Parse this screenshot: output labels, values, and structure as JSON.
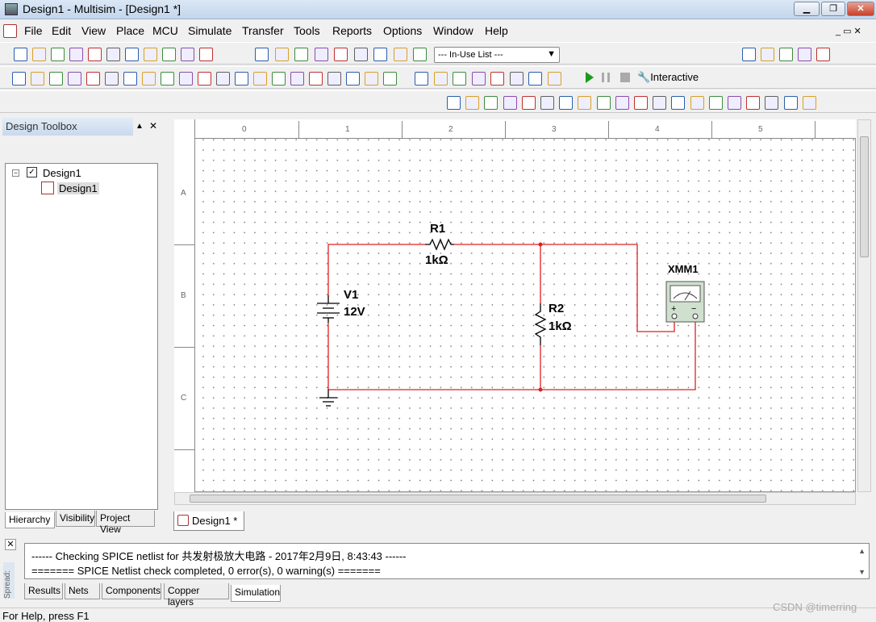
{
  "window": {
    "title": "Design1 - Multisim - [Design1 *]",
    "min": "▁",
    "max": "❐",
    "close": "✕"
  },
  "menu": [
    "File",
    "Edit",
    "View",
    "Place",
    "MCU",
    "Simulate",
    "Transfer",
    "Tools",
    "Reports",
    "Options",
    "Window",
    "Help"
  ],
  "toolbar": {
    "standard": [
      "new",
      "open",
      "open-sample",
      "save",
      "print",
      "print-preview",
      "cut",
      "copy",
      "paste",
      "undo",
      "redo"
    ],
    "view": [
      "toggle-grid",
      "spreadsheet",
      "database",
      "postprocessor",
      "grapher",
      "description",
      "breadboard",
      "component-wizard",
      "database-manager"
    ],
    "inuse_list": "--- In-Use List ---",
    "components": [
      "source",
      "resistor",
      "diode",
      "transistor",
      "analog",
      "ttl",
      "cmos",
      "mcu",
      "advanced-peripherals",
      "misc-digital",
      "mixed",
      "indicator",
      "power",
      "misc",
      "rf",
      "electromech",
      "ni",
      "connector",
      "mcu-module",
      "hier-block",
      "bus"
    ],
    "probes": [
      "voltage-probe",
      "current-probe",
      "power-probe",
      "diff-voltage-probe",
      "voltage-current-probe",
      "reference-probe",
      "digital-probe",
      "probe-settings"
    ],
    "simulate": {
      "run": "run",
      "pause": "pause",
      "stop": "stop",
      "interactive": "Interactive"
    },
    "zoom": [
      "zoom-in",
      "zoom-out",
      "zoom-area",
      "zoom-fit",
      "full-screen"
    ],
    "instruments": [
      "multimeter",
      "function-generator",
      "wattmeter",
      "oscilloscope",
      "4ch-oscilloscope",
      "bode-plotter",
      "frequency-counter",
      "word-generator",
      "logic-converter",
      "logic-analyzer",
      "iv-analyzer",
      "distortion-analyzer",
      "spectrum-analyzer",
      "network-analyzer",
      "agilent-fg",
      "agilent-mm",
      "agilent-scope",
      "tektronix-scope",
      "labview",
      "current-probe"
    ]
  },
  "design_toolbox": {
    "title": "Design Toolbox",
    "tree": {
      "root": "Design1",
      "child": "Design1"
    },
    "tabs": [
      "Hierarchy",
      "Visibility",
      "Project View"
    ]
  },
  "canvas": {
    "col_labels": [
      "0",
      "1",
      "2",
      "3",
      "4",
      "5"
    ],
    "row_labels": [
      "A",
      "B",
      "C"
    ],
    "tab": "Design1 *"
  },
  "circuit": {
    "wire_color": "#e02020",
    "components": {
      "r1": {
        "name": "R1",
        "value": "1kΩ"
      },
      "r2": {
        "name": "R2",
        "value": "1kΩ"
      },
      "v1": {
        "name": "V1",
        "value": "12V"
      },
      "xmm1": {
        "name": "XMM1"
      }
    }
  },
  "output": {
    "lines": [
      "------ Checking SPICE netlist for 共发射极放大电路 - 2017年2月9日, 8:43:43 ------",
      "======= SPICE Netlist check completed, 0 error(s), 0 warning(s) ======="
    ],
    "side_label": "Spread:",
    "tabs": [
      "Results",
      "Nets",
      "Components",
      "Copper layers",
      "Simulation"
    ],
    "active_tab": "Simulation"
  },
  "status": "For Help, press F1",
  "watermark": "CSDN @timerring"
}
